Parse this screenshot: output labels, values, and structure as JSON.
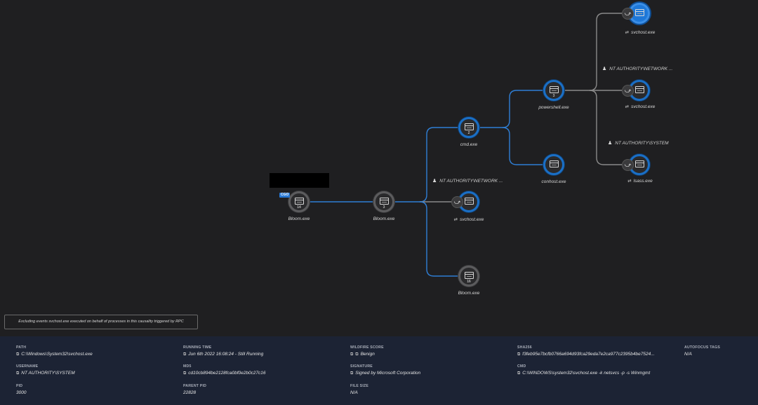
{
  "graph": {
    "nodes": [
      {
        "id": "n1",
        "name": "Bloom.exe",
        "count": "14",
        "badge": "CGO"
      },
      {
        "id": "n2",
        "name": "Bloom.exe",
        "count": "3"
      },
      {
        "id": "n3",
        "name": "cmd.exe",
        "count": "2"
      },
      {
        "id": "n4",
        "name": "svchost.exe"
      },
      {
        "id": "n5",
        "name": "Bloom.exe",
        "count": "16"
      },
      {
        "id": "n6",
        "name": "powershell.exe",
        "count": "3"
      },
      {
        "id": "n7",
        "name": "conhost.exe"
      },
      {
        "id": "n8",
        "name": "svchost.exe"
      },
      {
        "id": "n9",
        "name": "svchost.exe"
      },
      {
        "id": "n10",
        "name": "lsass.exe"
      }
    ],
    "user_labels": {
      "svchost_network": "NT AUTHORITY\\NETWORK ...",
      "top_network": "NT AUTHORITY\\NETWORK ...",
      "system": "NT AUTHORITY\\SYSTEM"
    },
    "colors": {
      "edge_blue": "#2f7fd6",
      "edge_gray": "#8a8a8a",
      "selected": "#1e78d8"
    }
  },
  "notice": "Excluding events svchost.exe executed on behalf of processes in this causality triggered by RPC",
  "details": {
    "path": {
      "label": "PATH",
      "value": "C:\\Windows\\System32\\svchost.exe"
    },
    "running_time": {
      "label": "RUNNING TIME",
      "value": "Jun 6th 2022 16:08:24 - Still Running"
    },
    "wildfire": {
      "label": "WILDFIRE SCORE",
      "value": "Benign"
    },
    "sha256": {
      "label": "SHA256",
      "value": "f3feb95e7bcfb0766a694d93fca29eda7e2ca977c2395b4be7524..."
    },
    "autofocus": {
      "label": "AUTOFOCUS TAGS",
      "value": "N/A"
    },
    "username": {
      "label": "USERNAME",
      "value": "NT AUTHORITY\\SYSTEM"
    },
    "md5": {
      "label": "MD5",
      "value": "cd10cb894be2128fca0bf0e2b0c27c16"
    },
    "signature": {
      "label": "SIGNATURE",
      "value": "Signed by Microsoft Corporation"
    },
    "cmd": {
      "label": "CMD",
      "value": "C:\\WINDOWS\\system32\\svchost.exe -k netsvcs -p -s Winmgmt"
    },
    "pid": {
      "label": "PID",
      "value": "3000"
    },
    "parent_pid": {
      "label": "PARENT PID",
      "value": "22828"
    },
    "file_size": {
      "label": "FILE SIZE",
      "value": "N/A"
    }
  }
}
